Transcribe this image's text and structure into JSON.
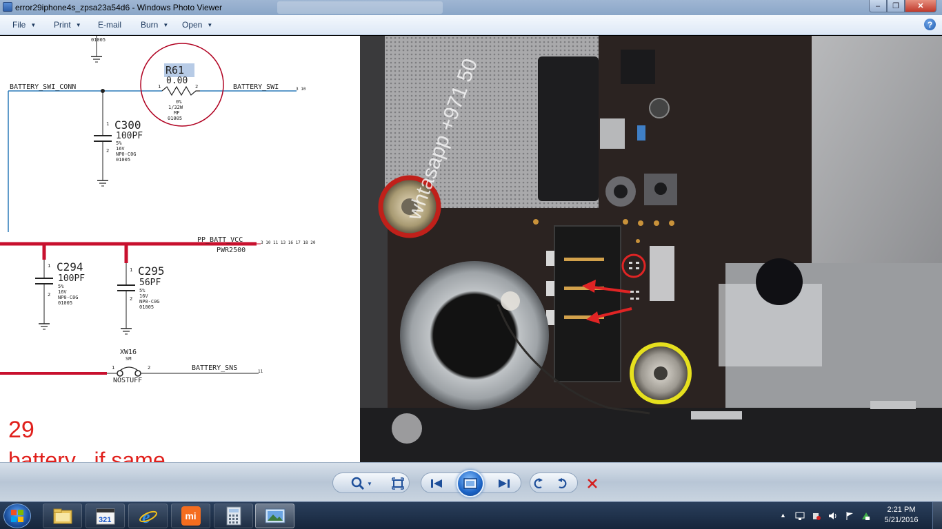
{
  "window": {
    "title": "error29iphone4s_zpsa23a54d6 - Windows Photo Viewer",
    "minimize_glyph": "‒",
    "maximize_glyph": "❐",
    "close_glyph": "✕"
  },
  "menu": {
    "items": [
      {
        "label": "File",
        "has_arrow": true
      },
      {
        "label": "Print",
        "has_arrow": true
      },
      {
        "label": "E-mail",
        "has_arrow": false
      },
      {
        "label": "Burn",
        "has_arrow": true
      },
      {
        "label": "Open",
        "has_arrow": true
      }
    ],
    "help_glyph": "?"
  },
  "schematic": {
    "top_partno": "01005",
    "r61_name": "R61",
    "r61_value": "0.00",
    "r61_pin1": "1",
    "r61_pin2": "2",
    "r61_spec1": "0%",
    "r61_spec2": "1/32W",
    "r61_spec3": "MF",
    "r61_spec4": "01005",
    "net_batt_conn": "BATTERY_SWI_CONN",
    "net_batt_swi": "BATTERY_SWI",
    "net_batt_swi_refs": "3 10",
    "c300_name": "C300",
    "c300_value": "100PF",
    "c300_spec1": "5%",
    "c300_spec2": "16V",
    "c300_spec3": "NP0-C0G",
    "c300_spec4": "01005",
    "net_pp_batt": "PP_BATT_VCC",
    "net_pp_batt_refs": "3 10 11 13 16 17 18 20",
    "net_pwr": "PWR2500",
    "c294_name": "C294",
    "c294_value": "100PF",
    "c294_spec1": "5%",
    "c294_spec2": "16V",
    "c294_spec3": "NP0-C0G",
    "c294_spec4": "01005",
    "c295_name": "C295",
    "c295_value": "56PF",
    "c295_spec1": "5%",
    "c295_spec2": "16V",
    "c295_spec3": "NP0-C0G",
    "c295_spec4": "01005",
    "cap_pin1": "1",
    "cap_pin2": "2",
    "xw_name": "XW16",
    "xw_type": "SM",
    "xw_note": "NOSTUFF",
    "net_batt_sns": "BATTERY_SNS",
    "net_batt_sns_ref": "11",
    "error_number": "29",
    "error_text": "battery , if same"
  },
  "photo": {
    "watermark": "whtasapp +971 50"
  },
  "taskbar": {
    "time": "2:21 PM",
    "date": "5/21/2016",
    "mi_label": "mi"
  },
  "colors": {
    "titlebar": "#8aa6c8",
    "menubar": "#dde8f6",
    "schem_red": "#c8102e",
    "schem_blue": "#2a7ab8",
    "taskbar": "#16263c"
  }
}
